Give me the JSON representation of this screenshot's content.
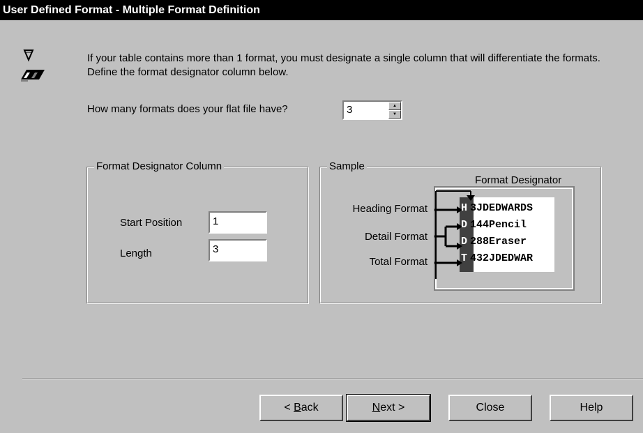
{
  "window": {
    "title": "User Defined Format - Multiple Format Definition"
  },
  "intro": {
    "text": "If your table contains more than 1 format, you must designate a single column that will differentiate the formats.  Define the format designator column below."
  },
  "formats": {
    "question": "How many formats does your flat file have?",
    "value": "3"
  },
  "designator_group": {
    "title": "Format Designator Column",
    "start_label": "Start Position",
    "start_value": "1",
    "length_label": "Length",
    "length_value": "3"
  },
  "sample_group": {
    "title": "Sample",
    "designator_label": "Format Designator",
    "labels": [
      "Heading Format",
      "Detail Format",
      "Total Format"
    ],
    "rows": [
      {
        "code": "H",
        "rest": "3JDEDWARDS"
      },
      {
        "code": "D",
        "rest": "144Pencil"
      },
      {
        "code": "D",
        "rest": "288Eraser"
      },
      {
        "code": "T",
        "rest": "432JDEDWAR"
      }
    ]
  },
  "buttons": {
    "back_pre": "< ",
    "back_u": "B",
    "back_post": "ack",
    "next_u": "N",
    "next_post": "ext >",
    "close": "Close",
    "help": "Help"
  },
  "icons": {
    "wizard": "wizard-icon",
    "spin_up": "up-arrow-icon",
    "spin_down": "down-arrow-icon"
  }
}
